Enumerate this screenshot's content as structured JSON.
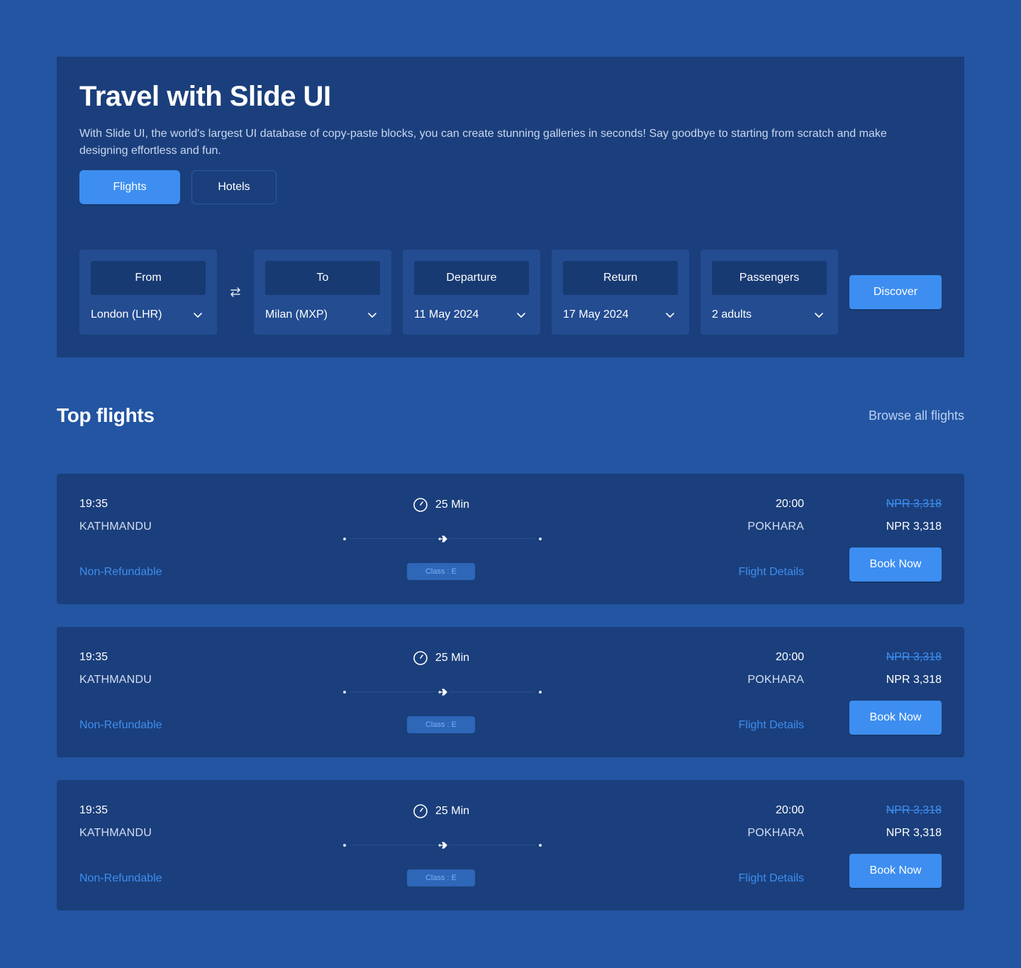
{
  "colors": {
    "page_bg": "#2355a3",
    "panel_bg": "#1b3f7c",
    "accent": "#3d8ef0",
    "text": "#ffffff"
  },
  "hero": {
    "title": "Travel with Slide UI",
    "description": "With Slide UI, the world's largest UI database of copy-paste blocks, you can create stunning galleries in seconds! Say goodbye to starting from scratch and make designing effortless and fun.",
    "tabs": [
      {
        "label": "Flights",
        "active": true
      },
      {
        "label": "Hotels",
        "active": false
      }
    ]
  },
  "search": {
    "fields": [
      {
        "label": "From",
        "value": "London (LHR)"
      },
      {
        "label": "To",
        "value": "Milan (MXP)"
      },
      {
        "label": "Departure",
        "value": "11 May 2024"
      },
      {
        "label": "Return",
        "value": "17 May 2024"
      },
      {
        "label": "Passengers",
        "value": "2 adults"
      }
    ],
    "swap_icon": "swap-arrows-icon",
    "discover_label": "Discover"
  },
  "top_flights": {
    "title": "Top flights",
    "browse_label": "Browse all flights",
    "flights": [
      {
        "dep_time": "19:35",
        "dep_city": "KATHMANDU",
        "refund": "Non-Refundable",
        "duration": "25 Min",
        "class": "Class : E",
        "arr_time": "20:00",
        "arr_city": "POKHARA",
        "details": "Flight Details",
        "old_price": "NPR 3,318",
        "price": "NPR 3,318",
        "book": "Book Now"
      },
      {
        "dep_time": "19:35",
        "dep_city": "KATHMANDU",
        "refund": "Non-Refundable",
        "duration": "25 Min",
        "class": "Class : E",
        "arr_time": "20:00",
        "arr_city": "POKHARA",
        "details": "Flight Details",
        "old_price": "NPR 3,318",
        "price": "NPR 3,318",
        "book": "Book Now"
      },
      {
        "dep_time": "19:35",
        "dep_city": "KATHMANDU",
        "refund": "Non-Refundable",
        "duration": "25 Min",
        "class": "Class : E",
        "arr_time": "20:00",
        "arr_city": "POKHARA",
        "details": "Flight Details",
        "old_price": "NPR 3,318",
        "price": "NPR 3,318",
        "book": "Book Now"
      }
    ]
  }
}
